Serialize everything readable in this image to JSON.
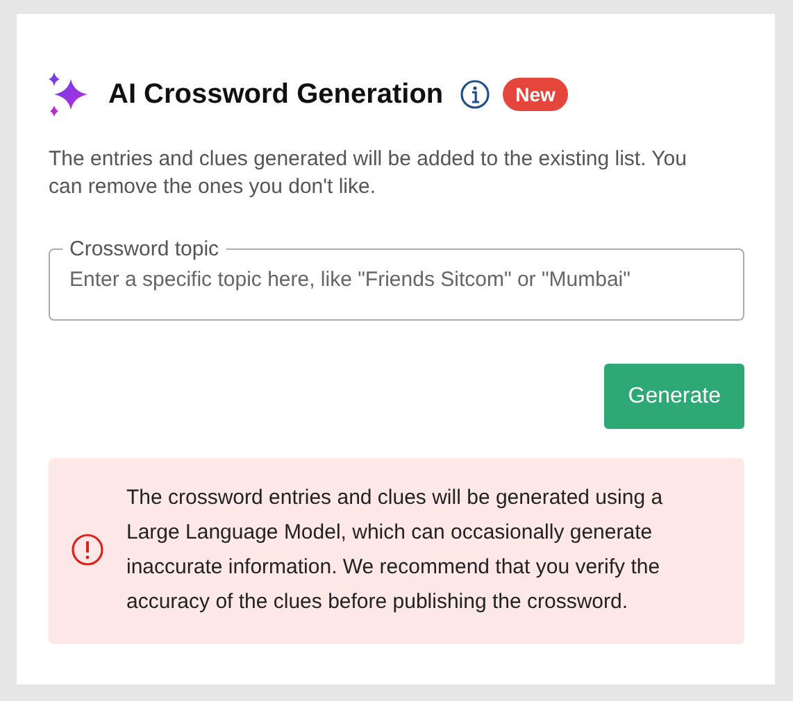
{
  "header": {
    "title": "AI Crossword Generation",
    "badge": "New"
  },
  "description": "The entries and clues generated will be added to the existing list. You can remove the ones you don't like.",
  "topic_field": {
    "label": "Crossword topic",
    "placeholder": "Enter a specific topic here, like \"Friends Sitcom\" or \"Mumbai\""
  },
  "buttons": [
    "Generate"
  ],
  "alert": {
    "kind": "warning",
    "text": "The crossword entries and clues will be generated using a Large Language Model, which can occasionally generate inaccurate information. We recommend that you verify the accuracy of the clues before publishing the crossword."
  }
}
